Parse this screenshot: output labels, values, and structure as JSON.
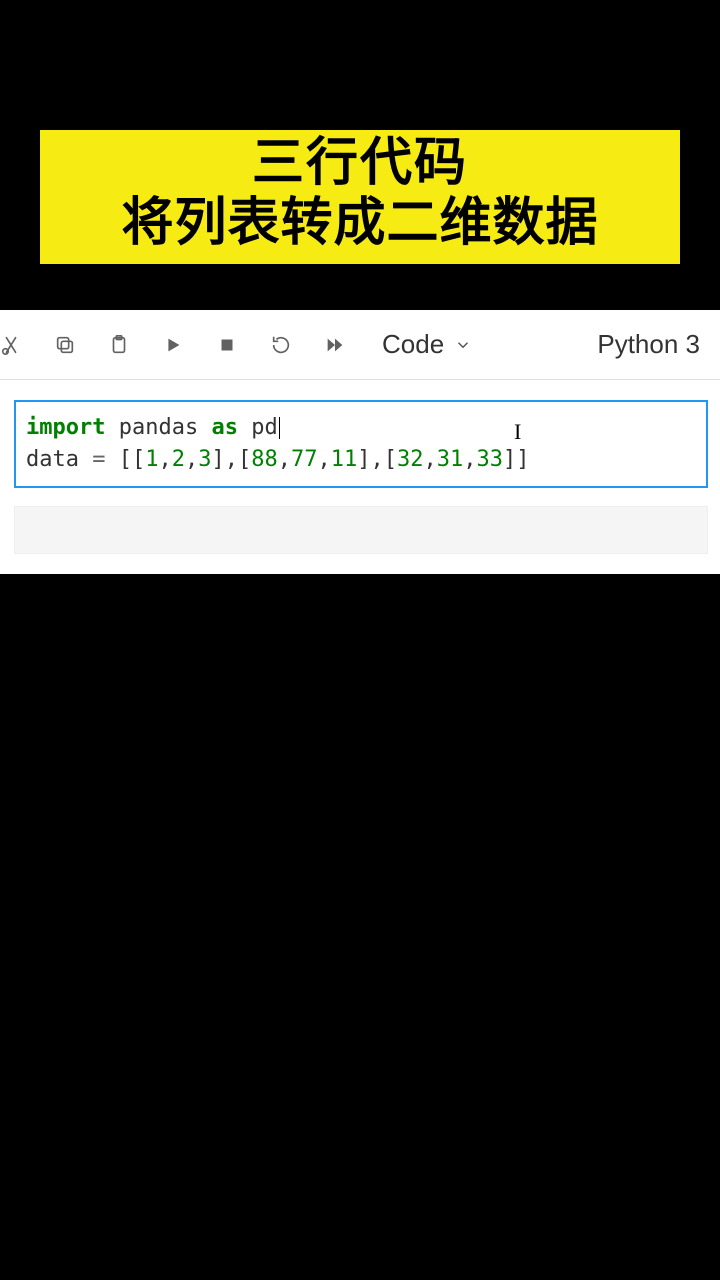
{
  "banner": {
    "line1": "三行代码",
    "line2": "将列表转成二维数据"
  },
  "toolbar": {
    "cellType": "Code",
    "kernel": "Python 3"
  },
  "code": {
    "kw_import": "import",
    "mod_pandas": " pandas ",
    "kw_as": "as",
    "mod_pd": " pd",
    "line2_pre": "data ",
    "line2_eq": "=",
    "line2_sp": " [[",
    "n1": "1",
    "c1": ",",
    "n2": "2",
    "c2": ",",
    "n3": "3",
    "b1": "],[",
    "n4": "88",
    "c3": ",",
    "n5": "77",
    "c4": ",",
    "n6": "11",
    "b2": "],[",
    "n7": "32",
    "c5": ",",
    "n8": "31",
    "c6": ",",
    "n9": "33",
    "b3": "]]"
  }
}
